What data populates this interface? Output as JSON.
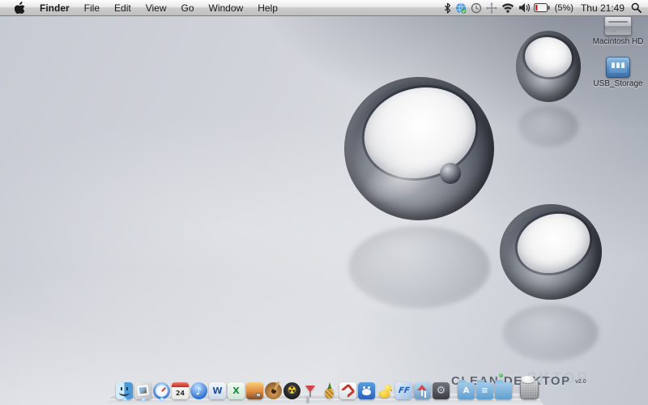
{
  "menu_bar": {
    "menus": [
      "Finder",
      "File",
      "Edit",
      "View",
      "Go",
      "Window",
      "Help"
    ],
    "active_app": "Finder",
    "status": {
      "battery_label": "(5%)",
      "clock": "Thu 21:49",
      "icons": [
        "bluetooth",
        "sync-globe",
        "history-clock",
        "crosshair",
        "wifi",
        "volume",
        "battery-low",
        "spotlight"
      ]
    }
  },
  "desktop": {
    "icons": [
      {
        "label": "Macintosh HD",
        "type": "internal-drive"
      },
      {
        "label": "USB_Storage",
        "type": "usb-network-drive"
      }
    ],
    "wallpaper_text": {
      "primary": "CLEAN DESKTOP",
      "version": "v2.0",
      "ghost": "SKTOP"
    },
    "spheres": [
      "large-center",
      "small-top-right",
      "medium-bottom-right"
    ]
  },
  "dock": {
    "apps": [
      {
        "name": "finder",
        "type": "finder",
        "running": true
      },
      {
        "name": "preview",
        "type": "preview",
        "running": true
      },
      {
        "name": "safari",
        "type": "safari",
        "running": true
      },
      {
        "name": "ical",
        "type": "ical",
        "glyph": "24"
      },
      {
        "name": "itunes",
        "type": "itunes",
        "glyph": "♪"
      },
      {
        "name": "word",
        "type": "word",
        "glyph": "W"
      },
      {
        "name": "excel",
        "type": "excel",
        "glyph": "X"
      },
      {
        "name": "iphoto",
        "type": "iphoto"
      },
      {
        "name": "garageband",
        "type": "garageband"
      },
      {
        "name": "toast-burner",
        "type": "toast",
        "glyph": "☢"
      },
      {
        "name": "cocktail",
        "type": "cocktail"
      },
      {
        "name": "pineapple-app",
        "type": "pineapple"
      },
      {
        "name": "vmware-fusion",
        "type": "vmware"
      },
      {
        "name": "azureus",
        "type": "azureus"
      },
      {
        "name": "cyberduck",
        "type": "cyberduck"
      },
      {
        "name": "flip4mac",
        "type": "ff",
        "glyph": "FF"
      },
      {
        "name": "beach-photo-app",
        "type": "beach"
      },
      {
        "name": "gear-utility",
        "type": "gearapp",
        "glyph": "⚙"
      }
    ],
    "folders": [
      {
        "name": "applications-folder",
        "type": "folder",
        "glyph": "A"
      },
      {
        "name": "documents-folder",
        "type": "folder",
        "glyph": "≡"
      },
      {
        "name": "downloads-folder",
        "type": "folder"
      }
    ],
    "trash": {
      "name": "trash",
      "type": "trash",
      "full": true
    }
  },
  "colors": {
    "menubar_top": "#fdfdfd",
    "menubar_bottom": "#bfbfbf",
    "wallpaper_base": "#ced2d9",
    "wallpaper_dark_corner": "#5a6478",
    "battery_low": "#cc2222",
    "folder_blue": "#5f9fd0",
    "watermark_dark": "#4a5160",
    "watermark_ghost": "#bcc2cd"
  }
}
